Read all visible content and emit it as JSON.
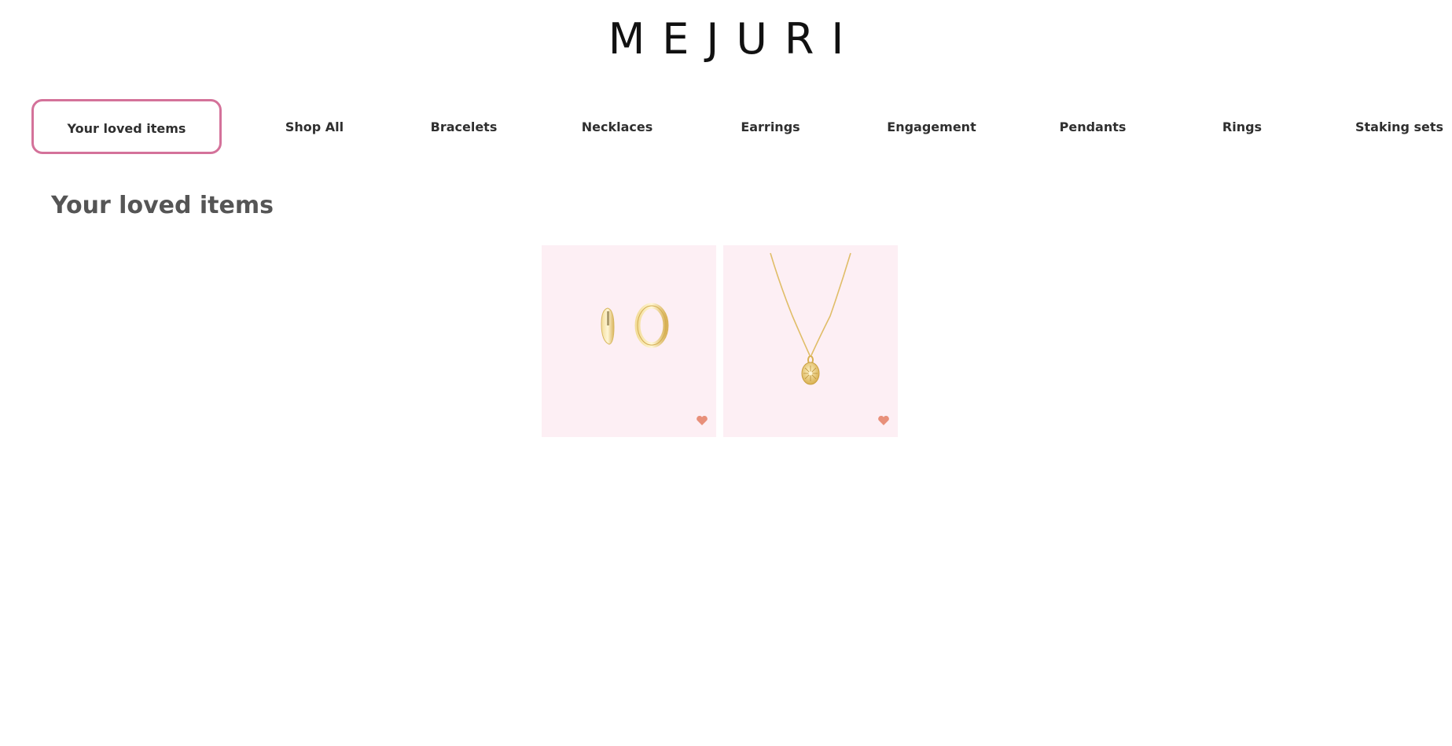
{
  "brand": {
    "logo_text": "MEJURI"
  },
  "nav": {
    "items": [
      {
        "label": "Your loved items",
        "active": true
      },
      {
        "label": "Shop All"
      },
      {
        "label": "Bracelets"
      },
      {
        "label": "Necklaces"
      },
      {
        "label": "Earrings"
      },
      {
        "label": "Engagement"
      },
      {
        "label": "Pendants"
      },
      {
        "label": "Rings"
      },
      {
        "label": "Staking sets"
      }
    ]
  },
  "main": {
    "title": "Your loved items",
    "products": [
      {
        "image": "gold-hoop-earrings",
        "loved": true,
        "heart_icon": "heart-icon"
      },
      {
        "image": "gold-pendant-necklace",
        "loved": true,
        "heart_icon": "heart-icon"
      }
    ]
  },
  "colors": {
    "accent": "#d4729a",
    "card_bg": "#fdeff4",
    "heart": "#e8907a",
    "gold": "#e6c36a"
  }
}
